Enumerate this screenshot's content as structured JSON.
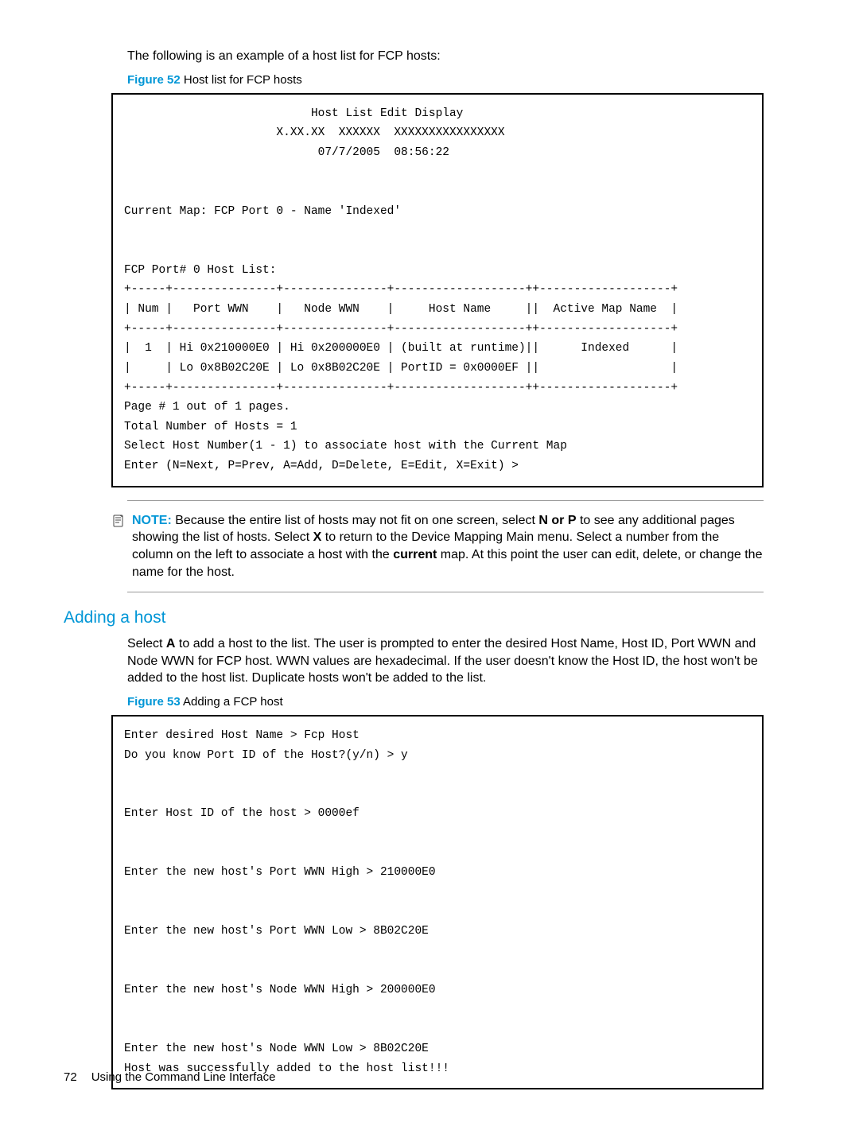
{
  "intro_text": "The following is an example of a host list for FCP hosts:",
  "figure52_label_prefix": "Figure 52",
  "figure52_label_text": " Host list for FCP hosts",
  "codeblock1": "                           Host List Edit Display\n                      X.XX.XX  XXXXXX  XXXXXXXXXXXXXXXX\n                            07/7/2005  08:56:22\n\n\nCurrent Map: FCP Port 0 - Name 'Indexed'\n\n\nFCP Port# 0 Host List:\n+-----+---------------+---------------+-------------------++-------------------+\n| Num |   Port WWN    |   Node WWN    |     Host Name     ||  Active Map Name  |\n+-----+---------------+---------------+-------------------++-------------------+\n|  1  | Hi 0x210000E0 | Hi 0x200000E0 | (built at runtime)||      Indexed      |\n|     | Lo 0x8B02C20E | Lo 0x8B02C20E | PortID = 0x0000EF ||                   |\n+-----+---------------+---------------+-------------------++-------------------+\nPage # 1 out of 1 pages.\nTotal Number of Hosts = 1\nSelect Host Number(1 - 1) to associate host with the Current Map\nEnter (N=Next, P=Prev, A=Add, D=Delete, E=Edit, X=Exit) >",
  "note_label": "NOTE:",
  "note_pre": "Because the entire list of hosts may not fit on one screen, select ",
  "note_bold1": "N or P",
  "note_mid1": " to see any additional pages showing the list of hosts. Select ",
  "note_bold2": "X",
  "note_mid2": " to return to the Device Mapping Main menu. Select a number from the column on the left to associate a host with the ",
  "note_bold3": "current",
  "note_post": " map. At this point the user can edit, delete, or change the name for the host.",
  "heading_adding": "Adding a host",
  "adding_text_pre": "Select ",
  "adding_bold": "A",
  "adding_text_post": " to add a host to the list. The user is prompted to enter the desired Host Name, Host ID, Port WWN and Node WWN for FCP host. WWN values are hexadecimal. If the user doesn't know the Host ID, the host won't be added to the host list. Duplicate hosts won't be added to the list.",
  "figure53_label_prefix": "Figure 53",
  "figure53_label_text": " Adding a FCP host",
  "codeblock2": "Enter desired Host Name > Fcp Host\nDo you know Port ID of the Host?(y/n) > y\n\n\nEnter Host ID of the host > 0000ef\n\n\nEnter the new host's Port WWN High > 210000E0\n\n\nEnter the new host's Port WWN Low > 8B02C20E\n\n\nEnter the new host's Node WWN High > 200000E0\n\n\nEnter the new host's Node WWN Low > 8B02C20E\nHost was successfully added to the host list!!!",
  "footer_pageno": "72",
  "footer_text": "Using the Command Line Interface"
}
